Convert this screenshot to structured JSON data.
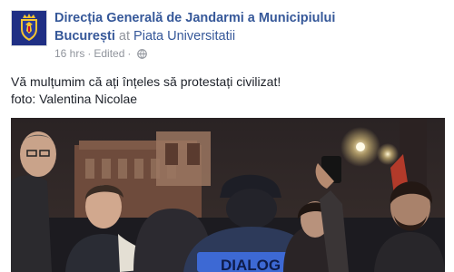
{
  "post": {
    "page_name_line1": "Direcția Generală de Jandarmi a Municipiului",
    "page_name_line2": "București",
    "at_text": "at",
    "location": "Piata Universitatii",
    "time": "16 hrs",
    "separator": "·",
    "edited": "Edited",
    "privacy_icon": "globe-icon",
    "message_line1": "Vă mulțumim că ați înțeles să protestați civilizat!",
    "message_line2": "foto: Valentina Nicolae"
  },
  "photo": {
    "vest_text": "DIALOG",
    "icon": "protest-photo"
  },
  "colors": {
    "link": "#365899",
    "meta": "#90949c",
    "text": "#1d2129",
    "avatar_bg": "#1f2f84",
    "vest_blue": "#3d69d4"
  }
}
